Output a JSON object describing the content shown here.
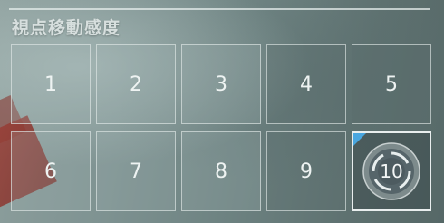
{
  "settings": {
    "title": "視点移動感度",
    "options": [
      {
        "label": "1"
      },
      {
        "label": "2"
      },
      {
        "label": "3"
      },
      {
        "label": "4"
      },
      {
        "label": "5"
      },
      {
        "label": "6"
      },
      {
        "label": "7"
      },
      {
        "label": "8"
      },
      {
        "label": "9"
      },
      {
        "label": "10"
      }
    ],
    "selected": "10",
    "colors": {
      "accent": "#4aa7e0",
      "text": "#eef3f2"
    },
    "selected_icon": "dial-icon"
  }
}
